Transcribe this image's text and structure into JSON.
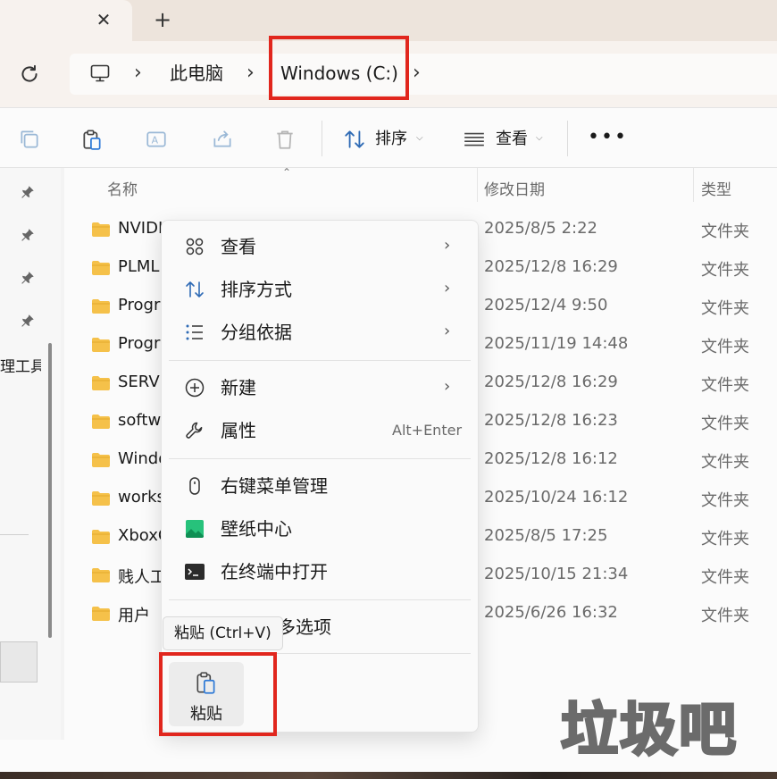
{
  "tab": {
    "close_glyph": "✕",
    "new_glyph": "+"
  },
  "address": {
    "refresh_icon": "refresh-icon",
    "computer_icon": "monitor-icon",
    "sep": "›",
    "crumbs": [
      "此电脑",
      "Windows (C:)"
    ]
  },
  "toolbar": {
    "sort_label": "排序",
    "view_label": "查看",
    "more_glyph": "•••",
    "caret": "⌵"
  },
  "columns": {
    "name": "名称",
    "date": "修改日期",
    "type": "类型"
  },
  "nav": {
    "partial_label": "理工具"
  },
  "files": [
    {
      "name": "NVIDI",
      "date": "2025/8/5 2:22",
      "type": "文件夹"
    },
    {
      "name": "PLML",
      "date": "2025/12/8 16:29",
      "type": "文件夹"
    },
    {
      "name": "Progr",
      "date": "2025/12/4 9:50",
      "type": "文件夹"
    },
    {
      "name": "Progr",
      "date": "2025/11/19 14:48",
      "type": "文件夹"
    },
    {
      "name": "SERVI",
      "date": "2025/12/8 16:29",
      "type": "文件夹"
    },
    {
      "name": "softwa",
      "date": "2025/12/8 16:23",
      "type": "文件夹"
    },
    {
      "name": "Windo",
      "date": "2025/12/8 16:12",
      "type": "文件夹"
    },
    {
      "name": "works",
      "date": "2025/10/24 16:12",
      "type": "文件夹"
    },
    {
      "name": "XboxG",
      "date": "2025/8/5 17:25",
      "type": "文件夹"
    },
    {
      "name": "贱人工",
      "date": "2025/10/15 21:34",
      "type": "文件夹"
    },
    {
      "name": "用户",
      "date": "2025/6/26 16:32",
      "type": "文件夹"
    }
  ],
  "menu": {
    "view": "查看",
    "sort": "排序方式",
    "group": "分组依据",
    "new": "新建",
    "properties": "属性",
    "properties_shortcut": "Alt+Enter",
    "manager": "右键菜单管理",
    "wallpaper": "壁纸中心",
    "terminal": "在终端中打开",
    "more_partial": "多选项",
    "arrow": "›",
    "paste": "粘贴"
  },
  "tooltip": "粘贴 (Ctrl+V)",
  "watermark": "垃圾吧",
  "colors": {
    "highlight": "#e1261d",
    "folder": "#f5c14a"
  }
}
